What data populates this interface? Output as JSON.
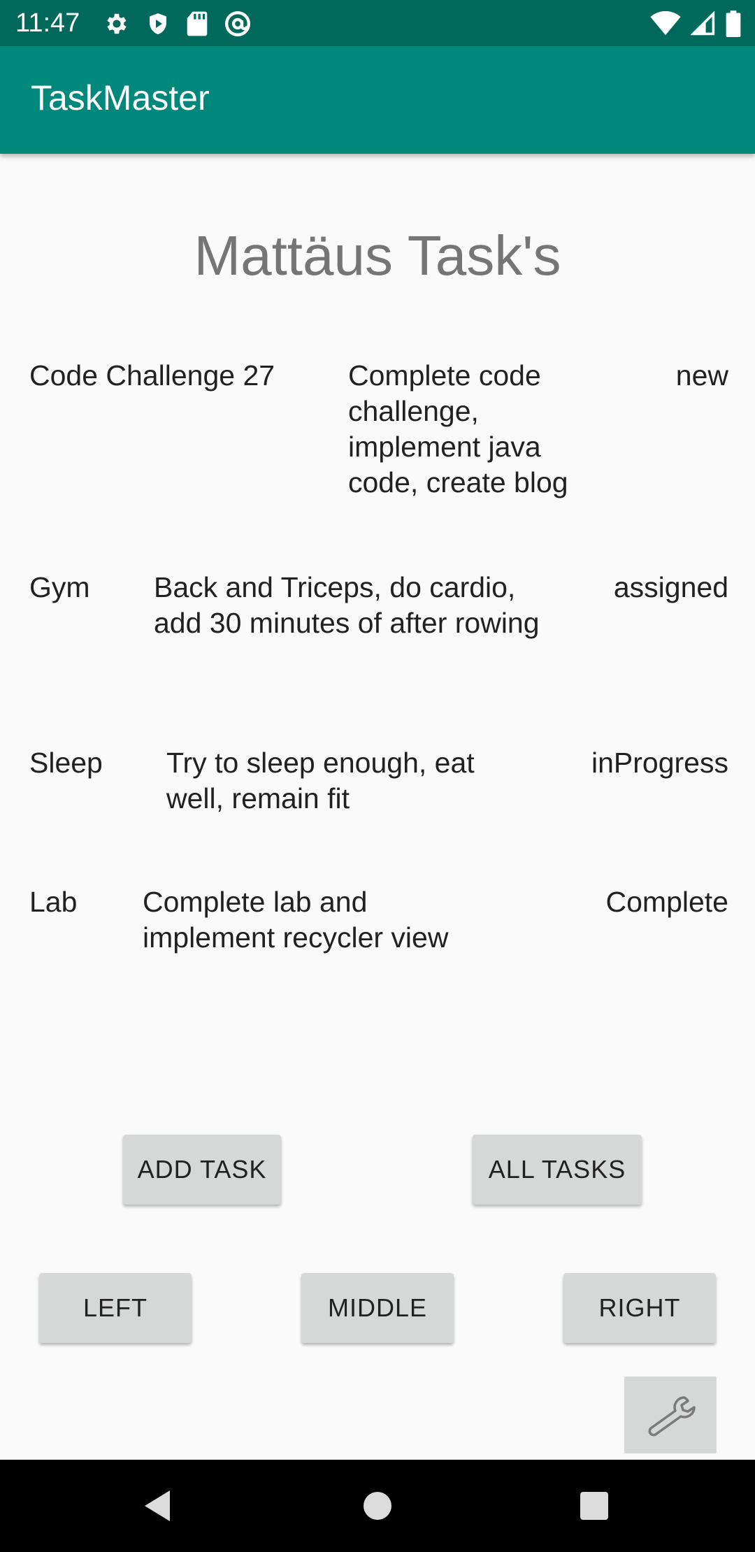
{
  "status_bar": {
    "time": "11:47",
    "left_icons": [
      "gear-icon",
      "shield-icon",
      "sd-card-icon",
      "at-sign-icon"
    ],
    "right_icons": [
      "wifi-icon",
      "cell-signal-icon",
      "battery-icon"
    ]
  },
  "app_bar": {
    "title": "TaskMaster",
    "color": "#00897b",
    "status_color": "#00695c"
  },
  "main": {
    "heading": "Mattäus Task's",
    "tasks": [
      {
        "title": "Code Challenge 27",
        "body": "Complete code challenge, implement java code, create blog",
        "state": "new"
      },
      {
        "title": "Gym",
        "body": "Back and Triceps, do cardio, add 30 minutes of after rowing",
        "state": "assigned"
      },
      {
        "title": "Sleep",
        "body": "Try to sleep enough, eat well, remain fit",
        "state": "inProgress"
      },
      {
        "title": "Lab",
        "body": "Complete lab and implement recycler view",
        "state": "Complete"
      }
    ]
  },
  "buttons": {
    "add_task": "ADD TASK",
    "all_tasks": "ALL TASKS",
    "left": "LEFT",
    "middle": "MIDDLE",
    "right": "RIGHT",
    "settings_icon": "wrench-icon"
  },
  "nav_bar": {
    "back": "back-icon",
    "home": "home-icon",
    "recents": "recents-icon"
  }
}
